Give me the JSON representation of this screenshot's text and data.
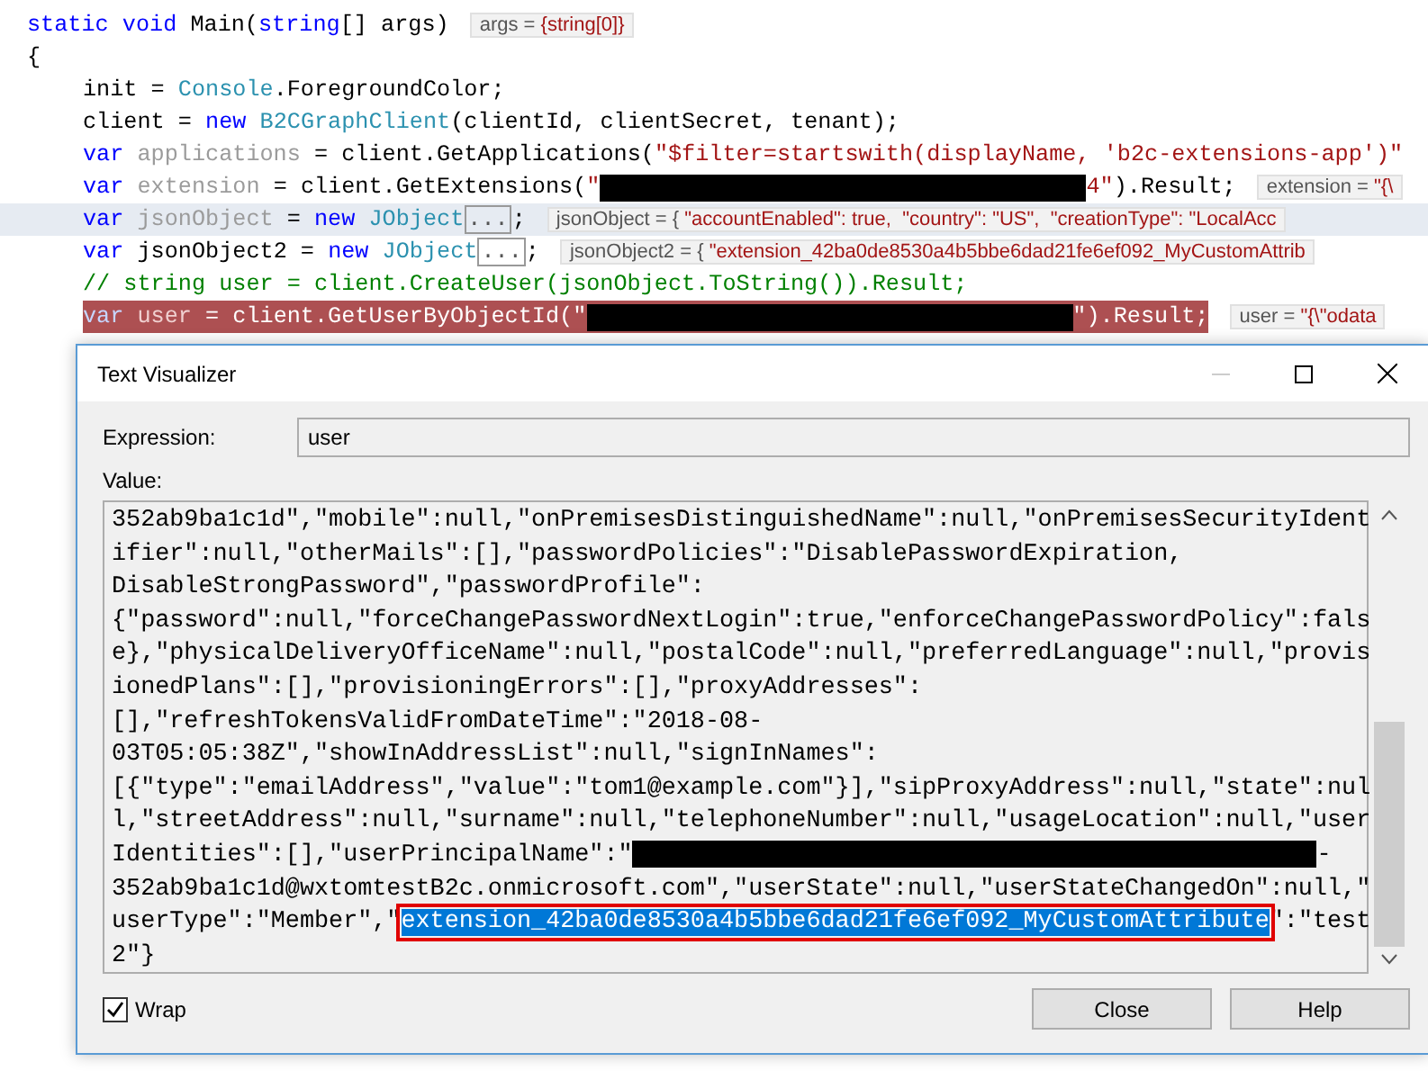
{
  "code_lines": [
    {
      "indent": false,
      "hovered": false,
      "current": false,
      "tokens": [
        {
          "kind": "keyword",
          "text": "static void"
        },
        {
          "kind": "plain",
          "text": " Main("
        },
        {
          "kind": "keyword",
          "text": "string"
        },
        {
          "kind": "plain",
          "text": "[] args)"
        }
      ],
      "tip": {
        "label": "args = ",
        "value": "{string[0]}"
      }
    },
    {
      "indent": false,
      "hovered": false,
      "current": false,
      "tokens": [
        {
          "kind": "plain",
          "text": "{"
        }
      ]
    },
    {
      "indent": true,
      "hovered": false,
      "current": false,
      "tokens": [
        {
          "kind": "plain",
          "text": "init = "
        },
        {
          "kind": "type",
          "text": "Console"
        },
        {
          "kind": "plain",
          "text": ".ForegroundColor;"
        }
      ]
    },
    {
      "indent": true,
      "hovered": false,
      "current": false,
      "tokens": [
        {
          "kind": "plain",
          "text": "client = "
        },
        {
          "kind": "keyword",
          "text": "new "
        },
        {
          "kind": "type",
          "text": "B2CGraphClient"
        },
        {
          "kind": "plain",
          "text": "(clientId, clientSecret, tenant);"
        }
      ]
    },
    {
      "indent": true,
      "hovered": false,
      "current": false,
      "tokens": [
        {
          "kind": "keyword",
          "text": "var "
        },
        {
          "kind": "unused",
          "text": "applications"
        },
        {
          "kind": "plain",
          "text": " = client.GetApplications("
        },
        {
          "kind": "string",
          "text": "\"$filter=startswith(displayName, 'b2c-extensions-app')\""
        }
      ]
    },
    {
      "indent": true,
      "hovered": false,
      "current": false,
      "tokens": [
        {
          "kind": "keyword",
          "text": "var "
        },
        {
          "kind": "unused",
          "text": "extension"
        },
        {
          "kind": "plain",
          "text": " = client.GetExtensions("
        },
        {
          "kind": "string",
          "text": "\""
        },
        {
          "kind": "redacted"
        },
        {
          "kind": "string",
          "text": "4\""
        },
        {
          "kind": "plain",
          "text": ").Result;"
        }
      ],
      "tip": {
        "label": "extension = ",
        "value": "\"{\\"
      }
    },
    {
      "indent": true,
      "hovered": true,
      "current": false,
      "tokens": [
        {
          "kind": "keyword",
          "text": "var "
        },
        {
          "kind": "unused",
          "text": "jsonObject"
        },
        {
          "kind": "plain",
          "text": " = "
        },
        {
          "kind": "keyword",
          "text": "new "
        },
        {
          "kind": "type",
          "text": "JObject"
        },
        {
          "kind": "collapsed",
          "text": "..."
        },
        {
          "kind": "plain",
          "text": ";"
        }
      ],
      "tip": {
        "label": "jsonObject = { ",
        "value": "\"accountEnabled\": true,  \"country\": \"US\",  \"creationType\": \"LocalAcc"
      }
    },
    {
      "indent": true,
      "hovered": false,
      "current": false,
      "tokens": [
        {
          "kind": "keyword",
          "text": "var"
        },
        {
          "kind": "plain",
          "text": " jsonObject2 = "
        },
        {
          "kind": "keyword",
          "text": "new "
        },
        {
          "kind": "type",
          "text": "JObject"
        },
        {
          "kind": "collapsed",
          "text": "..."
        },
        {
          "kind": "plain",
          "text": ";"
        }
      ],
      "tip": {
        "label": "jsonObject2 = { ",
        "value": "\"extension_42ba0de8530a4b5bbe6dad21fe6ef092_MyCustomAttrib"
      }
    },
    {
      "indent": true,
      "hovered": false,
      "current": false,
      "tokens": [
        {
          "kind": "comment",
          "text": "// string user = client.CreateUser(jsonObject.ToString()).Result;"
        }
      ]
    },
    {
      "indent": true,
      "hovered": false,
      "current": true,
      "tokens": [
        {
          "kind": "keyword",
          "text": "var "
        },
        {
          "kind": "unused",
          "text": "user"
        },
        {
          "kind": "plain",
          "text": " = client.GetUserByObjectId("
        },
        {
          "kind": "string",
          "text": "\""
        },
        {
          "kind": "redacted"
        },
        {
          "kind": "string",
          "text": "\""
        },
        {
          "kind": "plain",
          "text": ").Result;"
        }
      ],
      "tip": {
        "label": "user = ",
        "value": "\"{\\\"odata"
      }
    }
  ],
  "dialog": {
    "title": "Text Visualizer",
    "expression_label": "Expression:",
    "expression": "user",
    "value_label": "Value:",
    "value_lines": [
      [
        {
          "kind": "text",
          "text": "352ab9ba1c1d\",\"mobile\":null,\"onPremisesDistinguishedName\":null,\"onPremisesSecurityIdent"
        }
      ],
      [
        {
          "kind": "text",
          "text": "ifier\":null,\"otherMails\":[],\"passwordPolicies\":\"DisablePasswordExpiration,"
        }
      ],
      [
        {
          "kind": "text",
          "text": "DisableStrongPassword\",\"passwordProfile\":"
        }
      ],
      [
        {
          "kind": "text",
          "text": "{\"password\":null,\"forceChangePasswordNextLogin\":true,\"enforceChangePasswordPolicy\":fals"
        }
      ],
      [
        {
          "kind": "text",
          "text": "e},\"physicalDeliveryOfficeName\":null,\"postalCode\":null,\"preferredLanguage\":null,\"provis"
        }
      ],
      [
        {
          "kind": "text",
          "text": "ionedPlans\":[],\"provisioningErrors\":[],\"proxyAddresses\":"
        }
      ],
      [
        {
          "kind": "text",
          "text": "[],\"refreshTokensValidFromDateTime\":\"2018-08-"
        }
      ],
      [
        {
          "kind": "text",
          "text": "03T05:05:38Z\",\"showInAddressList\":null,\"signInNames\":"
        }
      ],
      [
        {
          "kind": "text",
          "text": "[{\"type\":\"emailAddress\",\"value\":\"tom1@example.com\"}],\"sipProxyAddress\":null,\"state\":nul"
        }
      ],
      [
        {
          "kind": "text",
          "text": "l,\"streetAddress\":null,\"surname\":null,\"telephoneNumber\":null,\"usageLocation\":null,\"user"
        }
      ],
      [
        {
          "kind": "text",
          "text": "Identities\":[],\"userPrincipalName\":\""
        },
        {
          "kind": "redacted"
        },
        {
          "kind": "text",
          "text": "-"
        }
      ],
      [
        {
          "kind": "text",
          "text": "352ab9ba1c1d@wxtomtestB2c.onmicrosoft.com\",\"userState\":null,\"userStateChangedOn\":null,\""
        }
      ],
      [
        {
          "kind": "text",
          "text": "userType\":\"Member\",\""
        },
        {
          "kind": "selected",
          "text": "extension_42ba0de8530a4b5bbe6dad21fe6ef092_MyCustomAttribute"
        },
        {
          "kind": "text",
          "text": "\":\"test"
        }
      ],
      [
        {
          "kind": "text",
          "text": "2\"}"
        }
      ]
    ],
    "wrap": {
      "label": "Wrap",
      "checked": true
    },
    "buttons": [
      "Close",
      "Help"
    ]
  }
}
